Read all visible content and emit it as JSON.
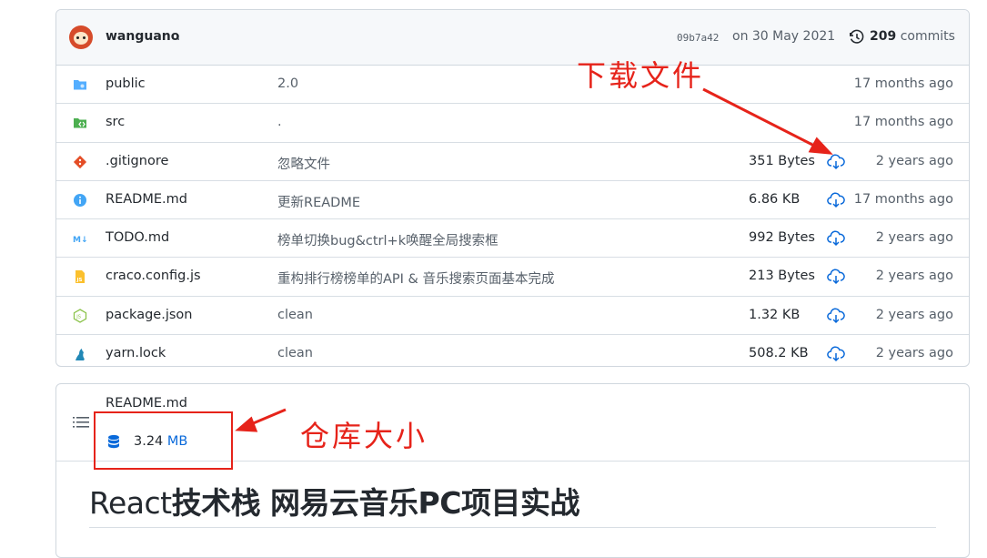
{
  "commit": {
    "author": "wanguano",
    "message": ".",
    "sha": "09b7a42",
    "date": "on 30 May 2021",
    "count": "209",
    "count_label": "commits"
  },
  "files": [
    {
      "name": "public",
      "type": "folder",
      "message": "2.0",
      "size": "",
      "age": "17 months ago",
      "icon": "folder-icon",
      "color": "#54aeff"
    },
    {
      "name": "src",
      "type": "folder",
      "message": ".",
      "size": "",
      "age": "17 months ago",
      "icon": "folder-src-icon",
      "color": "#4caf50"
    },
    {
      "name": ".gitignore",
      "type": "file",
      "message": "忽略文件",
      "size": "351 Bytes",
      "age": "2 years ago",
      "icon": "git-icon",
      "color": "#e44d26"
    },
    {
      "name": "README.md",
      "type": "file",
      "message": "更新README",
      "size": "6.86 KB",
      "age": "17 months ago",
      "icon": "info-icon",
      "color": "#42a5f5"
    },
    {
      "name": "TODO.md",
      "type": "file",
      "message": "榜单切换bug&ctrl+k唤醒全局搜索框",
      "size": "992 Bytes",
      "age": "2 years ago",
      "icon": "markdown-icon",
      "color": "#42a5f5"
    },
    {
      "name": "craco.config.js",
      "type": "file",
      "message": "重构排行榜榜单的API & 音乐搜索页面基本完成",
      "size": "213 Bytes",
      "age": "2 years ago",
      "icon": "js-icon",
      "color": "#fbc02d"
    },
    {
      "name": "package.json",
      "type": "file",
      "message": "clean",
      "size": "1.32 KB",
      "age": "2 years ago",
      "icon": "nodejs-icon",
      "color": "#8bc34a"
    },
    {
      "name": "yarn.lock",
      "type": "file",
      "message": "clean",
      "size": "508.2 KB",
      "age": "2 years ago",
      "icon": "yarn-icon",
      "color": "#2188b6"
    }
  ],
  "readme": {
    "title": "README.md",
    "size_value": "3.24",
    "size_unit": "MB",
    "heading_prefix": "React",
    "heading_rest": "技术栈 网易云音乐PC项目实战"
  },
  "annotations": {
    "download_label": "下载文件",
    "repo_size_label": "仓库大小",
    "color": "#e6231a"
  },
  "colors": {
    "link": "#0969da",
    "border": "#d0d7de",
    "header_bg": "#f6f8fa"
  }
}
